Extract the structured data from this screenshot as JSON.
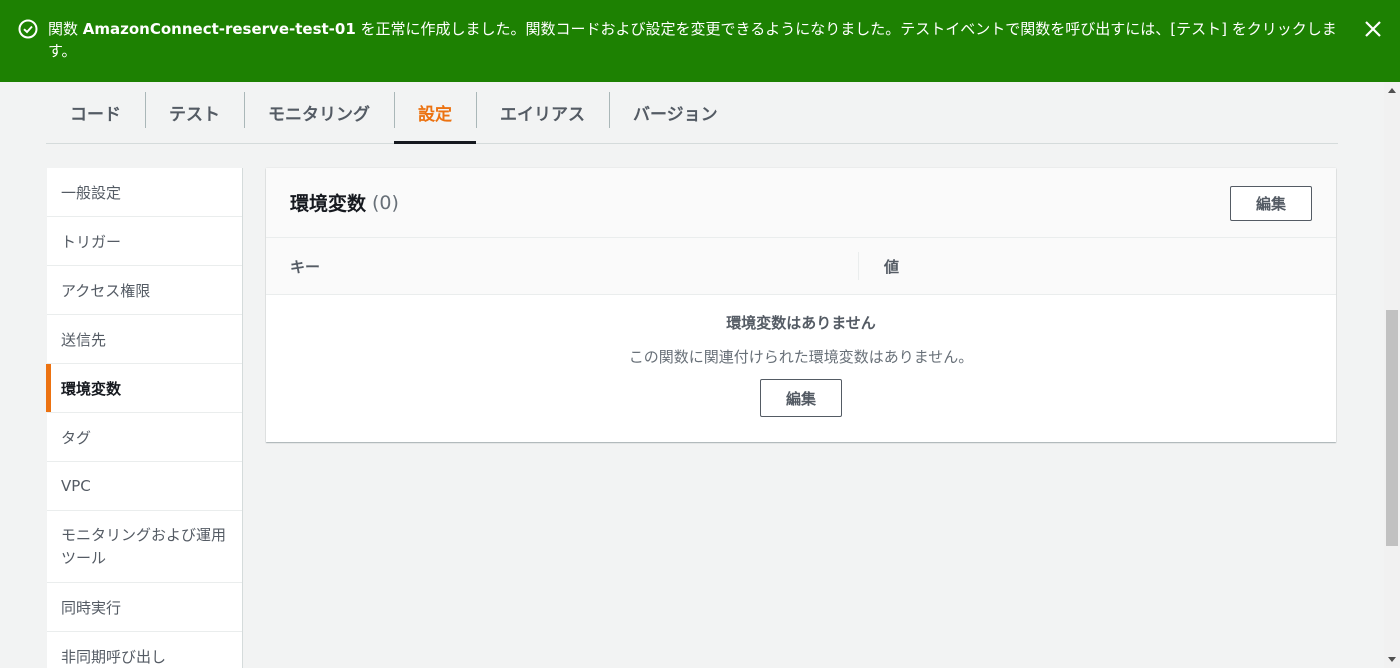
{
  "flash": {
    "message_prefix": "関数 ",
    "function_name": "AmazonConnect-reserve-test-01",
    "message_suffix": " を正常に作成しました。関数コードおよび設定を変更できるようになりました。テストイベントで関数を呼び出すには、[テスト] をクリックします。",
    "icon": "check-circle-icon",
    "close_icon": "close-icon",
    "color": "#1d8102"
  },
  "tabs": [
    {
      "label": "コード"
    },
    {
      "label": "テスト"
    },
    {
      "label": "モニタリング"
    },
    {
      "label": "設定",
      "active": true
    },
    {
      "label": "エイリアス"
    },
    {
      "label": "バージョン"
    }
  ],
  "sidenav": {
    "items": [
      {
        "label": "一般設定"
      },
      {
        "label": "トリガー"
      },
      {
        "label": "アクセス権限"
      },
      {
        "label": "送信先"
      },
      {
        "label": "環境変数",
        "active": true
      },
      {
        "label": "タグ"
      },
      {
        "label": "VPC"
      },
      {
        "label": "モニタリングおよび運用ツール"
      },
      {
        "label": "同時実行"
      },
      {
        "label": "非同期呼び出し"
      }
    ]
  },
  "env_vars": {
    "title": "環境変数",
    "count": "(0)",
    "edit_label": "編集",
    "columns": {
      "key": "キー",
      "value": "値"
    },
    "empty_title": "環境変数はありません",
    "empty_desc": "この関数に関連付けられた環境変数はありません。",
    "empty_edit_label": "編集"
  },
  "colors": {
    "accent": "#ec7211",
    "success": "#1d8102"
  }
}
